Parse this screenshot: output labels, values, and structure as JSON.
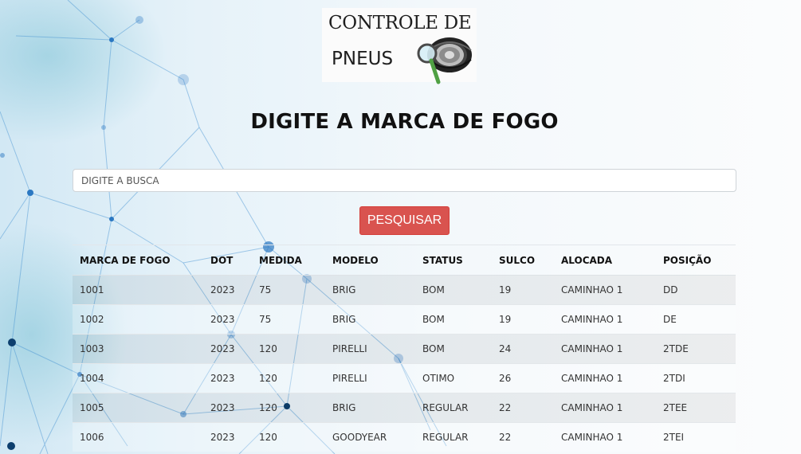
{
  "logo": {
    "line1": "CONTROLE DE",
    "line2": "PNEUS"
  },
  "heading": "DIGITE A MARCA DE FOGO",
  "search": {
    "placeholder": "DIGITE A BUSCA",
    "value": ""
  },
  "button": {
    "label": "PESQUISAR"
  },
  "table": {
    "headers": [
      "MARCA DE FOGO",
      "DOT",
      "MEDIDA",
      "MODELO",
      "STATUS",
      "SULCO",
      "ALOCADA",
      "POSIÇÃO"
    ],
    "rows": [
      [
        "1001",
        "2023",
        "75",
        "BRIG",
        "BOM",
        "19",
        "CAMINHAO 1",
        "DD"
      ],
      [
        "1002",
        "2023",
        "75",
        "BRIG",
        "BOM",
        "19",
        "CAMINHAO 1",
        "DE"
      ],
      [
        "1003",
        "2023",
        "120",
        "PIRELLI",
        "BOM",
        "24",
        "CAMINHAO 1",
        "2TDE"
      ],
      [
        "1004",
        "2023",
        "120",
        "PIRELLI",
        "OTIMO",
        "26",
        "CAMINHAO 1",
        "2TDI"
      ],
      [
        "1005",
        "2023",
        "120",
        "BRIG",
        "REGULAR",
        "22",
        "CAMINHAO 1",
        "2TEE"
      ],
      [
        "1006",
        "2023",
        "120",
        "GOODYEAR",
        "REGULAR",
        "22",
        "CAMINHAO 1",
        "2TEI"
      ]
    ]
  },
  "colors": {
    "button": "#d9534f",
    "heading": "#111111",
    "background": "#e6f2f9"
  }
}
